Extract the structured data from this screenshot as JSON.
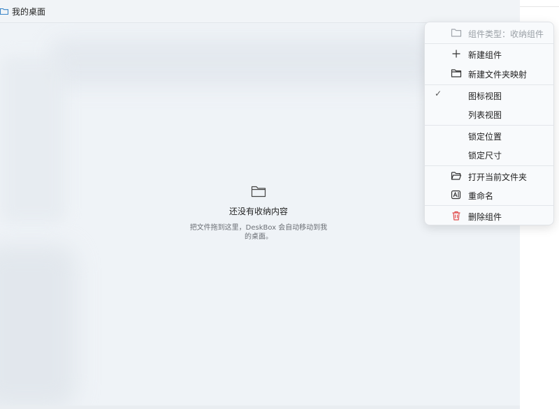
{
  "widget": {
    "title": "我的桌面",
    "empty_title": "还没有收纳内容",
    "empty_desc": "把文件拖到这里，DeskBox 会自动移动到我的桌面。"
  },
  "menu": {
    "type_label": "组件类型：收纳组件",
    "items": [
      {
        "label": "新建组件",
        "icon": "plus-icon"
      },
      {
        "label": "新建文件夹映射",
        "icon": "folder-icon"
      },
      {
        "label": "图标视图",
        "checked": true
      },
      {
        "label": "列表视图"
      },
      {
        "label": "锁定位置"
      },
      {
        "label": "锁定尺寸"
      },
      {
        "label": "打开当前文件夹",
        "icon": "folder-open-icon"
      },
      {
        "label": "重命名",
        "icon": "rename-icon"
      },
      {
        "label": "删除组件",
        "icon": "trash-icon"
      }
    ],
    "check_glyph": "✓"
  },
  "colors": {
    "accent": "#4a90d9",
    "danger": "#e04a4a",
    "panel_bg": "#eff3f7"
  }
}
